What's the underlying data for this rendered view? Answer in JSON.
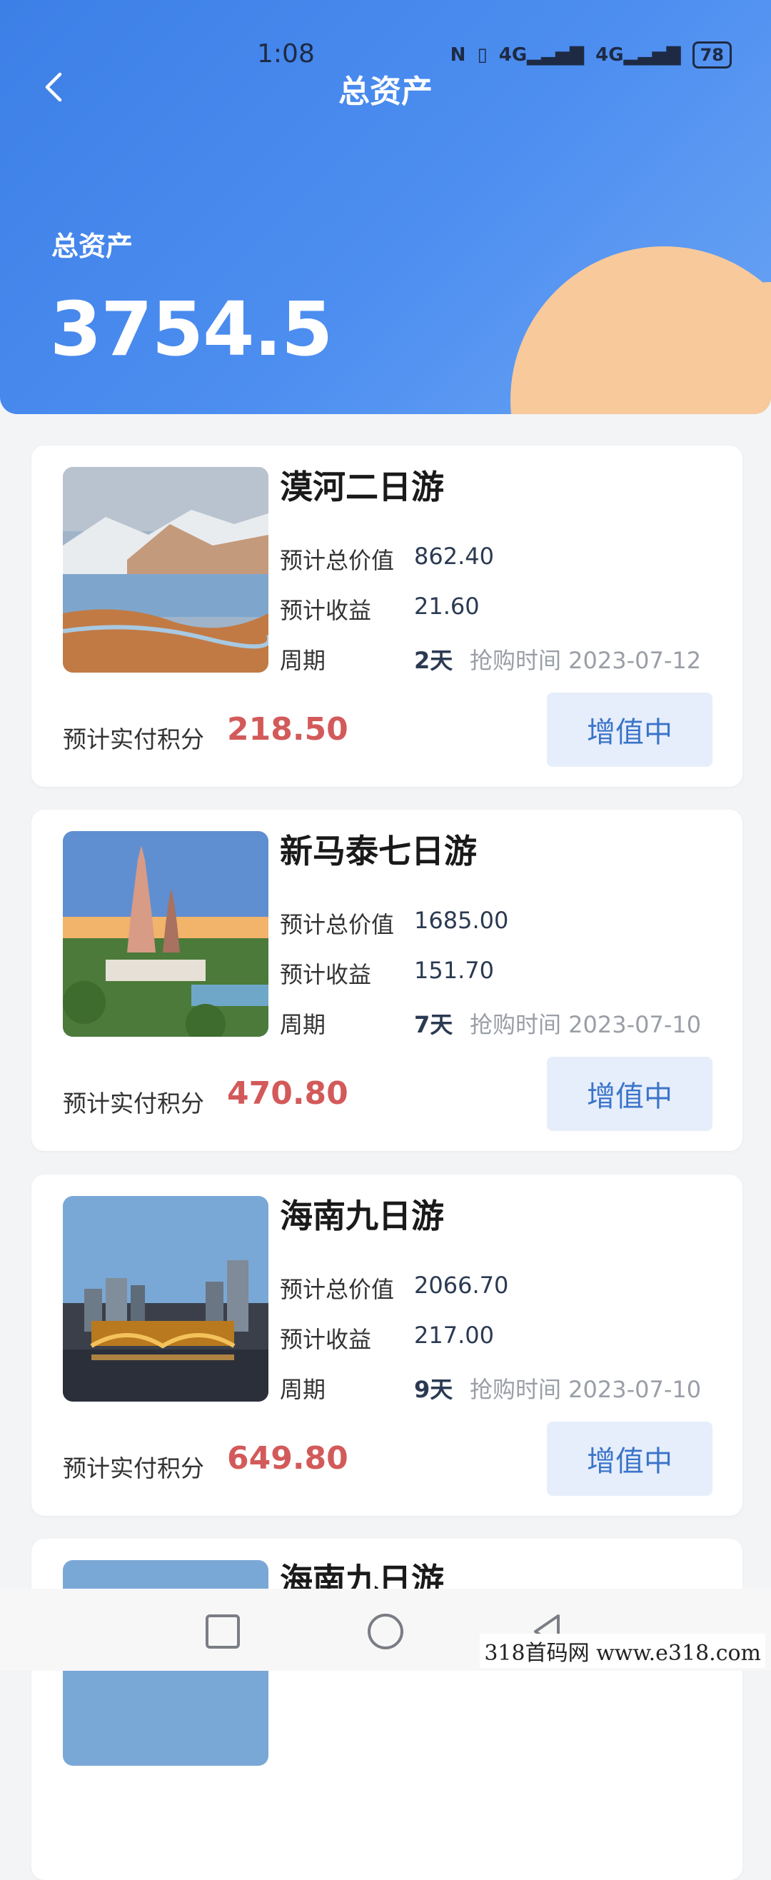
{
  "status_bar": {
    "time": "1:08",
    "icons": [
      "nfc-icon",
      "vibrate-icon",
      "signal-4g-icon",
      "signal-4g-icon"
    ],
    "battery": "78"
  },
  "header": {
    "title": "总资产",
    "total_label": "总资产",
    "total_value": "3754.5"
  },
  "cards": [
    {
      "title": "漠河二日游",
      "total_value_label": "预计总价值",
      "total_value": "862.40",
      "income_label": "预计收益",
      "income": "21.60",
      "cycle_label": "周期",
      "cycle": "2天",
      "buy_time": "抢购时间 2023-07-12",
      "pay_label": "预计实付积分",
      "pay_value": "218.50",
      "status": "增值中",
      "image": "snowy-mountain-river"
    },
    {
      "title": "新马泰七日游",
      "total_value_label": "预计总价值",
      "total_value": "1685.00",
      "income_label": "预计收益",
      "income": "151.70",
      "cycle_label": "周期",
      "cycle": "7天",
      "buy_time": "抢购时间 2023-07-10",
      "pay_label": "预计实付积分",
      "pay_value": "470.80",
      "status": "增值中",
      "image": "thai-pagoda"
    },
    {
      "title": "海南九日游",
      "total_value_label": "预计总价值",
      "total_value": "2066.70",
      "income_label": "预计收益",
      "income": "217.00",
      "cycle_label": "周期",
      "cycle": "9天",
      "buy_time": "抢购时间 2023-07-10",
      "pay_label": "预计实付积分",
      "pay_value": "649.80",
      "status": "增值中",
      "image": "city-bridge-night"
    },
    {
      "title": "海南九日游",
      "image": "city-bridge-night"
    }
  ],
  "watermark": "318首码网  www.e318.com"
}
